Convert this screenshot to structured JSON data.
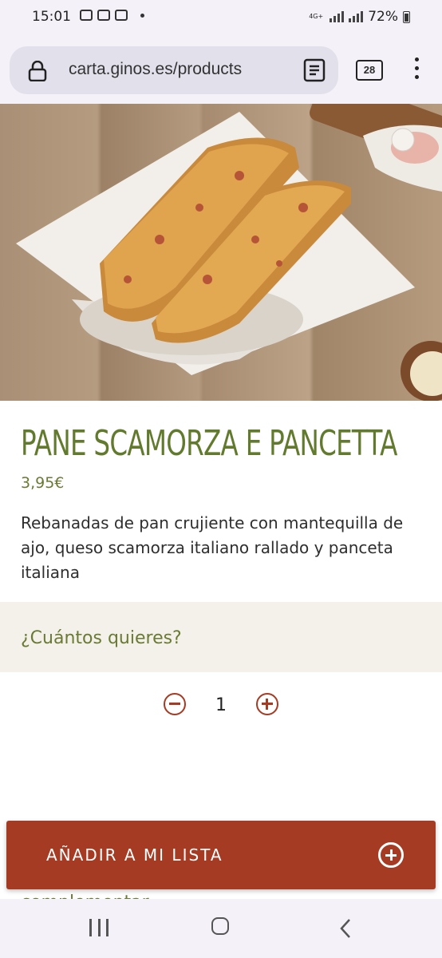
{
  "status_bar": {
    "time": "15:01",
    "network": "4G+",
    "battery": "72%",
    "notification_icons": [
      "instagram-icon",
      "message-icon",
      "message-icon",
      "dot-icon"
    ]
  },
  "browser": {
    "url": "carta.ginos.es/products",
    "tab_count": "28",
    "icons": [
      "lock-icon",
      "reader-mode-icon",
      "tabs-icon",
      "menu-icon"
    ]
  },
  "product": {
    "title": "PANE SCAMORZA E PANCETTA",
    "price": "3,95€",
    "description": "Rebanadas de pan crujiente con mantequilla de ajo, queso scamorza italiano rallado y panceta italiana",
    "image_icon": "product-photo"
  },
  "quantity": {
    "label": "¿Cuántos quieres?",
    "value": "1"
  },
  "cta": {
    "label": "AÑADIR A MI LISTA"
  },
  "partial_text": "complementar",
  "colors": {
    "accent_green": "#627a2e",
    "cta_red": "#a63b24",
    "qty_bg": "#f3f1ea"
  }
}
